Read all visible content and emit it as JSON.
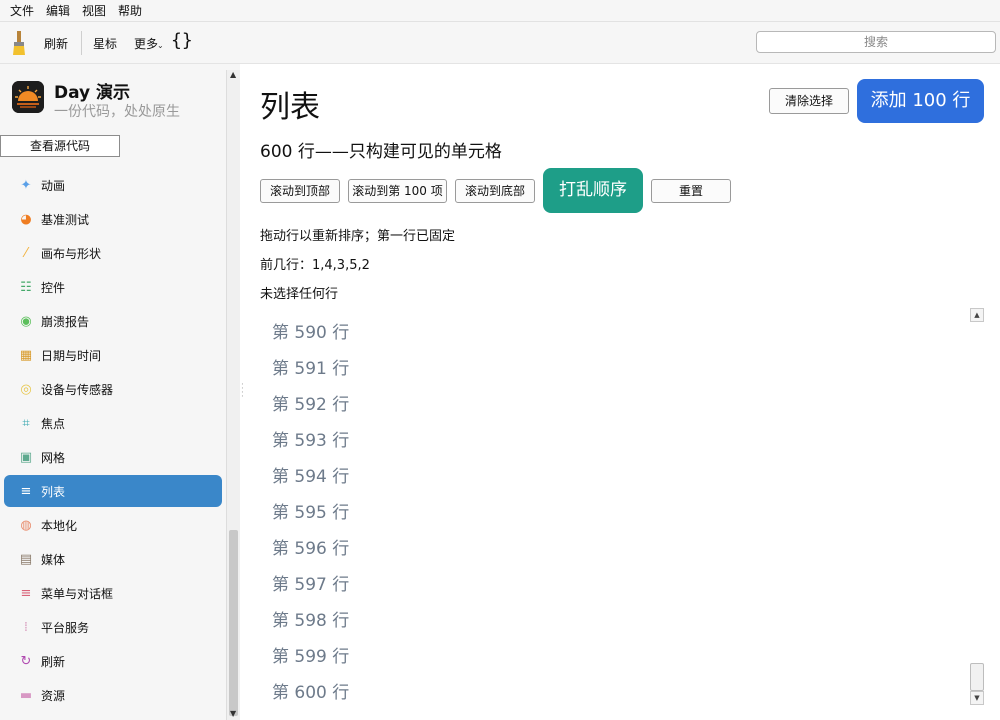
{
  "menu": [
    "文件",
    "编辑",
    "视图",
    "帮助"
  ],
  "toolbar": {
    "refresh_label": "刷新",
    "star_label": "星标",
    "more_label": "更多",
    "braces_label": "{}",
    "search_placeholder": "搜索"
  },
  "app": {
    "title": "Day 演示",
    "subtitle": "一份代码，处处原生",
    "view_source_label": "查看源代码"
  },
  "sidebar": {
    "items": [
      {
        "label": "动画",
        "icon": "sparkles-icon",
        "color": "#5aa0e8"
      },
      {
        "label": "基准测试",
        "icon": "gauge-icon",
        "color": "#ef7d22"
      },
      {
        "label": "画布与形状",
        "icon": "brush-icon",
        "color": "#f2b13c"
      },
      {
        "label": "控件",
        "icon": "sliders-icon",
        "color": "#46a96b"
      },
      {
        "label": "崩溃报告",
        "icon": "broadcast-icon",
        "color": "#5cbf5c"
      },
      {
        "label": "日期与时间",
        "icon": "calendar-icon",
        "color": "#d89a2a"
      },
      {
        "label": "设备与传感器",
        "icon": "sensor-icon",
        "color": "#e6c64a"
      },
      {
        "label": "焦点",
        "icon": "focus-icon",
        "color": "#3aa8b0"
      },
      {
        "label": "网格",
        "icon": "grid-icon",
        "color": "#5faa8f"
      },
      {
        "label": "列表",
        "icon": "list-icon",
        "color": "#ffffff",
        "active": true
      },
      {
        "label": "本地化",
        "icon": "globe-icon",
        "color": "#e88a6a"
      },
      {
        "label": "媒体",
        "icon": "clapper-icon",
        "color": "#8a7a6a"
      },
      {
        "label": "菜单与对话框",
        "icon": "menu-icon",
        "color": "#d9647a"
      },
      {
        "label": "平台服务",
        "icon": "dots-icon",
        "color": "#d9a0c0"
      },
      {
        "label": "刷新",
        "icon": "refresh-icon",
        "color": "#b04ab0"
      },
      {
        "label": "资源",
        "icon": "folder-icon",
        "color": "#d898c4"
      }
    ]
  },
  "main": {
    "title": "列表",
    "clear_selection_label": "清除选择",
    "add_rows_label": "添加 100 行",
    "subtitle": "600 行——只构建可见的单元格",
    "buttons": {
      "scroll_top": "滚动到顶部",
      "scroll_100": "滚动到第 100 项",
      "scroll_bottom": "滚动到底部",
      "shuffle": "打乱顺序",
      "reset": "重置"
    },
    "hint": "拖动行以重新排序；第一行已固定",
    "first_rows": "前几行：1,4,3,5,2",
    "selection_status": "未选择任何行",
    "rows": [
      "第 590 行",
      "第 591 行",
      "第 592 行",
      "第 593 行",
      "第 594 行",
      "第 595 行",
      "第 596 行",
      "第 597 行",
      "第 598 行",
      "第 599 行",
      "第 600 行"
    ]
  },
  "colors": {
    "accent_blue": "#2f6fdd",
    "accent_green": "#1e9e88",
    "sidebar_active": "#3a87c9"
  }
}
